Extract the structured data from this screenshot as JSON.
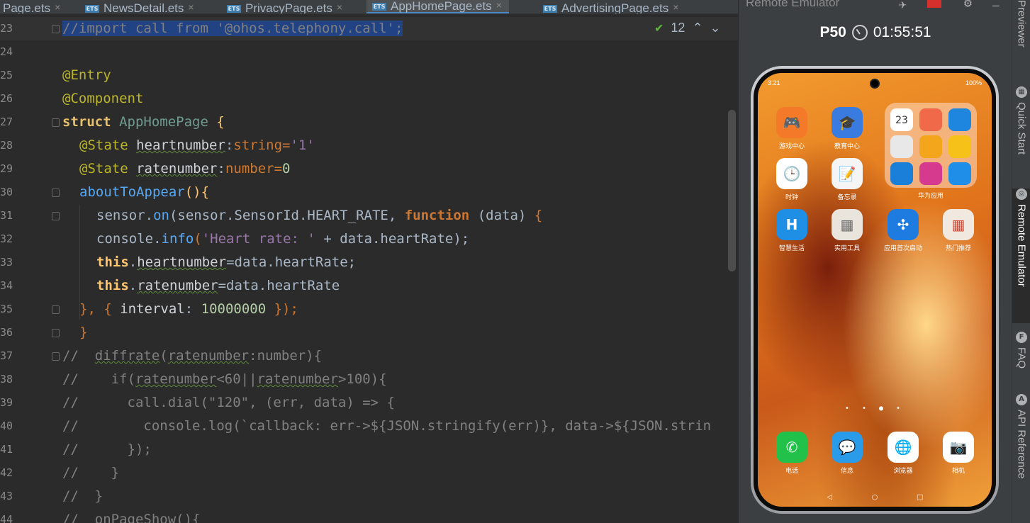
{
  "tabs": [
    {
      "label": "Page.ets",
      "icon": false,
      "active": false
    },
    {
      "label": "NewsDetail.ets",
      "icon": true,
      "active": false
    },
    {
      "label": "PrivacyPage.ets",
      "icon": true,
      "active": false
    },
    {
      "label": "AppHomePage.ets",
      "icon": true,
      "active": true
    },
    {
      "label": "AdvertisingPage.ets",
      "icon": true,
      "active": false
    }
  ],
  "tab_icon_text": "ETS",
  "tab_close_glyph": "×",
  "editor": {
    "inspection_count": "12",
    "line_numbers": [
      "23",
      "24",
      "25",
      "26",
      "27",
      "28",
      "29",
      "30",
      "31",
      "32",
      "33",
      "34",
      "35",
      "36",
      "37",
      "38",
      "39",
      "40",
      "41",
      "42",
      "43",
      "44"
    ],
    "lines": {
      "l23": "//import call from '@ohos.telephony.call';",
      "l25": "@Entry",
      "l26": "@Component",
      "l27a": "struct",
      "l27b": "AppHomePage",
      "l27c": "{",
      "l28a": "@State",
      "l28b": "heartnumber",
      "l28c": ":",
      "l28d": "string",
      "l28e": "=",
      "l28f": "'1'",
      "l29a": "@State",
      "l29b": "ratenumber",
      "l29c": ":",
      "l29d": "number",
      "l29e": "=",
      "l29f": "0",
      "l30a": "aboutToAppear",
      "l30b": "(){",
      "l31a": "sensor.",
      "l31b": "on",
      "l31c": "(sensor.SensorId.HEART_RATE,",
      "l31d": "function",
      "l31e": "(data)",
      "l31f": "{",
      "l32a": "console.",
      "l32b": "info",
      "l32c": "(",
      "l32d": "'Heart rate: '",
      "l32e": "+ data.heartRate);",
      "l33a": "this",
      "l33b": ".",
      "l33c": "heartnumber",
      "l33d": "=data.heartRate;",
      "l34a": "this",
      "l34b": ".",
      "l34c": "ratenumber",
      "l34d": "=data.heartRate",
      "l35a": "}, {",
      "l35b": "interval",
      "l35c": ":",
      "l35d": "10000000",
      "l35e": "});",
      "l36": "}",
      "l37a": "//  ",
      "l37b": "diffrate",
      "l37c": "(",
      "l37d": "ratenumber",
      "l37e": ":number){",
      "l38a": "//    if(",
      "l38b": "ratenumber",
      "l38c": "<60||",
      "l38d": "ratenumber",
      "l38e": ">100){",
      "l39": "//      call.dial(\"120\", (err, data) => {",
      "l40": "//        console.log(`callback: err->${JSON.stringify(err)}, data->${JSON.strin",
      "l41": "//      });",
      "l42": "//    }",
      "l43": "//  }",
      "l44": "//  onPageShow(){"
    }
  },
  "emulator": {
    "panel_title": "Remote Emulator",
    "device_name": "P50",
    "timer": "01:55:51",
    "status_time": "3:21",
    "status_right": "100%",
    "apps": [
      {
        "label": "游戏中心",
        "color": "#f47a2a",
        "glyph": "🎮"
      },
      {
        "label": "教育中心",
        "color": "#3a7be0",
        "glyph": "🎓"
      },
      {
        "label": "时钟",
        "color": "#ffffff",
        "glyph": "🕒"
      },
      {
        "label": "备忘录",
        "color": "#f5f5f5",
        "glyph": "📝"
      },
      {
        "label": "智慧生活",
        "color": "#1f8fe6",
        "glyph": "H"
      },
      {
        "label": "实用工具",
        "color": "#e9e4dc",
        "glyph": "▦"
      },
      {
        "label": "应用首次启动",
        "color": "#1e7ce0",
        "glyph": "✣"
      },
      {
        "label": "热门推荐",
        "color": "#f1e9df",
        "glyph": "▦"
      }
    ],
    "folder_label": "华为应用",
    "folder_date": "23",
    "dock": [
      {
        "label": "电话",
        "color": "#22c14a",
        "glyph": "✆"
      },
      {
        "label": "信息",
        "color": "#2a9be8",
        "glyph": "💬"
      },
      {
        "label": "浏览器",
        "color": "#ffffff",
        "glyph": "🌐"
      },
      {
        "label": "相机",
        "color": "#ffffff",
        "glyph": "📷"
      }
    ],
    "page_dots": "• • ● •",
    "nav": [
      "◁",
      "○",
      "□"
    ]
  },
  "side_tabs": [
    {
      "label": "Previewer",
      "icon": "≡"
    },
    {
      "label": "Quick Start",
      "icon": "▦"
    },
    {
      "label": "Remote Emulator",
      "icon": "◎"
    },
    {
      "label": "FAQ",
      "icon": "F"
    },
    {
      "label": "API Reference",
      "icon": "A"
    }
  ]
}
